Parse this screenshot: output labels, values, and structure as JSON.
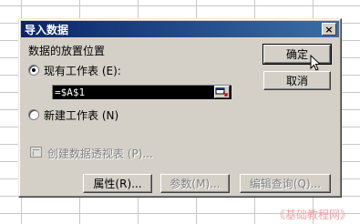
{
  "dialog": {
    "title": "导入数据",
    "close": "×",
    "placement_label": "数据的放置位置",
    "existing_sheet_label": "现有工作表 (E):",
    "existing_sheet_selected": true,
    "range_value": "=$A$1",
    "new_sheet_label": "新建工作表 (N)",
    "new_sheet_selected": false,
    "pivot_label": "创建数据透视表 (P)...",
    "buttons": {
      "ok": "确定",
      "cancel": "取消",
      "properties": "属性(R)...",
      "parameters": "参数(M)...",
      "edit_query": "编辑查询(Q)..."
    }
  },
  "watermark": "《基础教程网》",
  "icons": {
    "close": "close-icon",
    "range_picker": "range-picker-icon",
    "pivot": "pivot-table-icon",
    "cursor": "mouse-pointer-icon"
  }
}
